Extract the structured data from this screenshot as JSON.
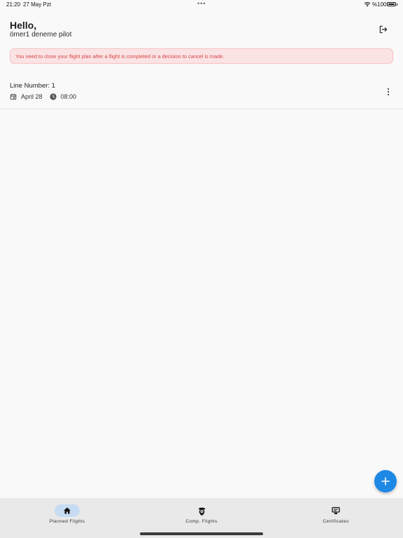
{
  "status_bar": {
    "time": "21:20",
    "date": "27 May Pzt",
    "dots": "•••",
    "battery": "%100"
  },
  "header": {
    "greeting": "Hello,",
    "user_name": "ömer1 deneme pilot",
    "logout_icon": "logout-icon"
  },
  "warning": {
    "text": "You need to close your flight plan after a flight is completed or a decision to cancel is made.",
    "color": "#d64545",
    "background": "#fbe3e4"
  },
  "flights": [
    {
      "line_number": "Line Number: 1",
      "date": "April 28",
      "time": "08:00"
    }
  ],
  "fab": {
    "icon": "plus-icon",
    "color": "#1e88e5"
  },
  "bottom_nav": {
    "items": [
      {
        "label": "Planned Flights",
        "icon": "home-icon",
        "active": true
      },
      {
        "label": "Comp. Flights",
        "icon": "pilot-icon",
        "active": false
      },
      {
        "label": "Certificates",
        "icon": "certificate-icon",
        "active": false
      }
    ],
    "active_color": "#c6dcf2"
  }
}
